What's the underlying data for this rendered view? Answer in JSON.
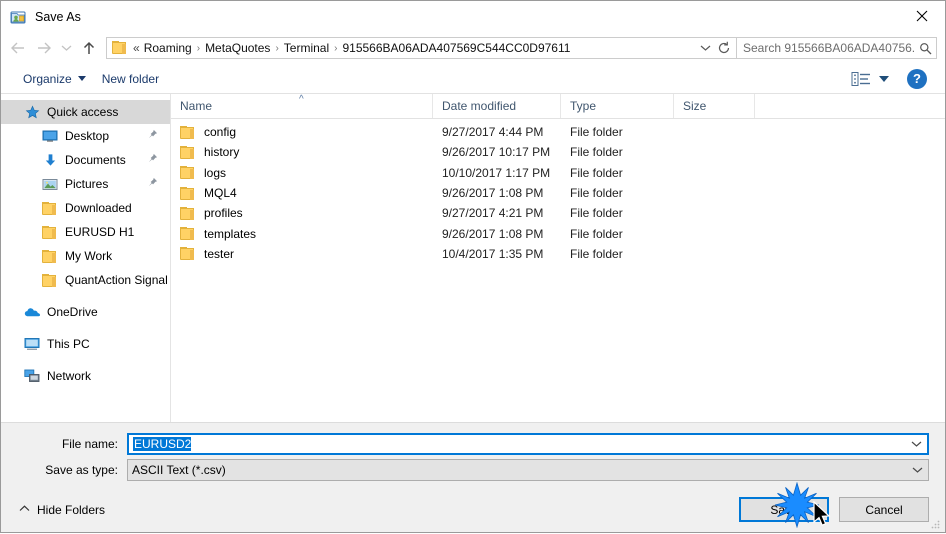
{
  "window": {
    "title": "Save As",
    "icon": "save-as-icon",
    "close_label": "✕"
  },
  "nav": {
    "back": "back-arrow",
    "forward": "forward-arrow",
    "recent": "recent-locations-chevron",
    "up": "up-arrow",
    "refresh": "refresh-icon"
  },
  "address": {
    "lead": "«",
    "separator": "›",
    "crumbs": [
      "Roaming",
      "MetaQuotes",
      "Terminal",
      "915566BA06ADA407569C544CC0D97611"
    ],
    "dropdown_icon": "chevron-down-icon"
  },
  "search": {
    "placeholder": "Search 915566BA06ADA40756...",
    "value": "",
    "icon": "search-icon"
  },
  "toolbar": {
    "organize_label": "Organize",
    "new_folder_label": "New folder",
    "view_icon": "list-view-icon",
    "view_caret": "chevron-down-icon",
    "help_label": "?"
  },
  "sidebar": {
    "items": [
      {
        "label": "Quick access",
        "icon": "star-icon",
        "level": 0,
        "selected": true,
        "pinned": false
      },
      {
        "label": "Desktop",
        "icon": "desktop-icon",
        "level": 1,
        "selected": false,
        "pinned": true
      },
      {
        "label": "Documents",
        "icon": "documents-download-icon",
        "level": 1,
        "selected": false,
        "pinned": true
      },
      {
        "label": "Pictures",
        "icon": "pictures-icon",
        "level": 1,
        "selected": false,
        "pinned": true
      },
      {
        "label": "Downloaded",
        "icon": "folder-icon",
        "level": 1,
        "selected": false,
        "pinned": false
      },
      {
        "label": "EURUSD H1",
        "icon": "folder-icon",
        "level": 1,
        "selected": false,
        "pinned": false
      },
      {
        "label": "My Work",
        "icon": "folder-icon",
        "level": 1,
        "selected": false,
        "pinned": false
      },
      {
        "label": "QuantAction Signal",
        "icon": "folder-icon",
        "level": 1,
        "selected": false,
        "pinned": false
      },
      {
        "label": "OneDrive",
        "icon": "onedrive-cloud-icon",
        "level": 0,
        "selected": false,
        "pinned": false,
        "gap_before": true
      },
      {
        "label": "This PC",
        "icon": "this-pc-icon",
        "level": 0,
        "selected": false,
        "pinned": false,
        "gap_before": true
      },
      {
        "label": "Network",
        "icon": "network-icon",
        "level": 0,
        "selected": false,
        "pinned": false,
        "gap_before": true
      }
    ]
  },
  "filelist": {
    "columns": [
      "Name",
      "Date modified",
      "Type",
      "Size"
    ],
    "sort_column": "Name",
    "sort_caret": "^",
    "rows": [
      {
        "name": "config",
        "date": "9/27/2017 4:44 PM",
        "type": "File folder",
        "size": ""
      },
      {
        "name": "history",
        "date": "9/26/2017 10:17 PM",
        "type": "File folder",
        "size": ""
      },
      {
        "name": "logs",
        "date": "10/10/2017 1:17 PM",
        "type": "File folder",
        "size": ""
      },
      {
        "name": "MQL4",
        "date": "9/26/2017 1:08 PM",
        "type": "File folder",
        "size": ""
      },
      {
        "name": "profiles",
        "date": "9/27/2017 4:21 PM",
        "type": "File folder",
        "size": ""
      },
      {
        "name": "templates",
        "date": "9/26/2017 1:08 PM",
        "type": "File folder",
        "size": ""
      },
      {
        "name": "tester",
        "date": "10/4/2017 1:35 PM",
        "type": "File folder",
        "size": ""
      }
    ]
  },
  "form": {
    "filename_label": "File name:",
    "filename_value": "EURUSD2",
    "filetype_label": "Save as type:",
    "filetype_value": "ASCII Text (*.csv)",
    "dropdown_icon": "chevron-down-icon"
  },
  "footer": {
    "hide_folders_label": "Hide Folders",
    "hide_folders_caret": "^",
    "save_label": "Save",
    "cancel_label": "Cancel"
  },
  "colors": {
    "accent": "#0078d7",
    "folder": "#ffd265",
    "selection": "#d8d8d8",
    "toolbar_text": "#1b3a6b",
    "column_header_text": "#40566e",
    "button_face": "#e1e1e1",
    "footer_bg": "#f0f0f0"
  },
  "overlay": {
    "click_effect": "click-starburst",
    "cursor": "mouse-pointer"
  }
}
